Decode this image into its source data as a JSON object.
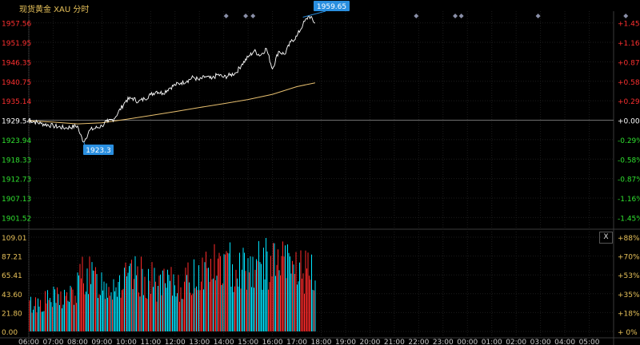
{
  "header": {
    "title": "现货黄金 XAU 分时"
  },
  "controls": {
    "close_label": "X"
  },
  "colors": {
    "background": "#000000",
    "price_line": "#ffffff",
    "avg_line": "#e8c070",
    "up": "#ff2a2a",
    "down": "#00e5ff",
    "axis_up": "#ff3030",
    "axis_down": "#2fe02f",
    "axis_neutral": "#ffffff",
    "volume_label": "#e8c25a",
    "marker": "#8a8fa8",
    "callout_bg": "#2a8fe0"
  },
  "chart_data": [
    {
      "type": "line",
      "title": "",
      "x_ticks": [
        "06:00",
        "07:00",
        "08:00",
        "09:00",
        "10:00",
        "11:00",
        "12:00",
        "13:00",
        "14:00",
        "15:00",
        "16:00",
        "17:00",
        "18:00",
        "19:00",
        "20:00",
        "21:00",
        "22:00",
        "23:00",
        "00:00",
        "01:00",
        "02:00",
        "03:00",
        "04:00",
        "05:00"
      ],
      "y_ticks_price": [
        1957.56,
        1951.95,
        1946.35,
        1940.75,
        1935.14,
        1929.54,
        1923.94,
        1918.33,
        1912.73,
        1907.13,
        1901.52
      ],
      "y_ticks_percent": [
        "+1.45%",
        "+1.16%",
        "+0.87%",
        "+0.58%",
        "+0.29%",
        "+0.00%",
        "-0.29%",
        "-0.58%",
        "-0.87%",
        "-1.16%",
        "-1.45%"
      ],
      "ylim": [
        1900.7,
        1958.4
      ],
      "reference_price": 1929.54,
      "high_label": "1959.65",
      "low_label": "1923.3",
      "session_hours": 24,
      "series": [
        {
          "name": "price",
          "hours": [
            0,
            0.5,
            1,
            1.5,
            2,
            2.1,
            2.25,
            2.5,
            3,
            3.2,
            3.25,
            3.5,
            4,
            4.25,
            4.5,
            4.75,
            5,
            5.25,
            5.5,
            5.75,
            6,
            6.25,
            6.5,
            6.75,
            7,
            7.25,
            7.5,
            7.75,
            8,
            8.25,
            8.5,
            8.75,
            9,
            9.25,
            9.5,
            9.75,
            10,
            10.25,
            10.5,
            10.75,
            11,
            11.25,
            11.5,
            11.75
          ],
          "values": [
            1929.6,
            1928.6,
            1927.9,
            1927.3,
            1927.9,
            1925.6,
            1923.3,
            1926.7,
            1927.9,
            1929.3,
            1929.0,
            1930.0,
            1935.3,
            1935.9,
            1934.9,
            1935.7,
            1936.9,
            1937.9,
            1937.3,
            1938.7,
            1939.7,
            1940.3,
            1940.9,
            1941.9,
            1941.1,
            1942.1,
            1941.4,
            1942.7,
            1941.9,
            1942.5,
            1943.2,
            1945.7,
            1947.7,
            1949.5,
            1948.2,
            1950.2,
            1944.3,
            1949.4,
            1948.5,
            1952.1,
            1953.7,
            1957.1,
            1959.65,
            1957.5
          ]
        },
        {
          "name": "average",
          "hours": [
            0,
            1,
            2,
            3,
            4,
            5,
            6,
            7,
            8,
            9,
            10,
            11,
            11.75
          ],
          "values": [
            1929.4,
            1929.0,
            1928.5,
            1928.8,
            1929.8,
            1930.9,
            1932.0,
            1933.2,
            1934.3,
            1935.5,
            1937.0,
            1939.2,
            1940.3
          ]
        }
      ]
    },
    {
      "type": "bar",
      "title": "",
      "y_ticks": [
        109.01,
        87.21,
        65.41,
        43.6,
        21.8,
        0.0
      ],
      "y_ticks_percent": [
        "+88%",
        "+70%",
        "+53%",
        "+35%",
        "+18%",
        "+ 0%"
      ],
      "ylim": [
        0,
        109.01
      ],
      "x_ticks": [
        "06:00",
        "07:00",
        "08:00",
        "09:00",
        "10:00",
        "11:00",
        "12:00",
        "13:00",
        "14:00",
        "15:00",
        "16:00",
        "17:00",
        "18:00",
        "19:00",
        "20:00",
        "21:00",
        "22:00",
        "23:00",
        "00:00",
        "01:00",
        "02:00",
        "03:00",
        "04:00",
        "05:00"
      ],
      "series": [
        {
          "name": "volume",
          "hour_anchors": [
            0,
            1,
            1.9,
            2.2,
            2.6,
            3.2,
            3.8,
            4.5,
            5.5,
            6.5,
            7.0,
            7.2,
            8.0,
            9.0,
            10.0,
            11.0,
            11.8
          ],
          "value_anchors": [
            40,
            50,
            55,
            92,
            80,
            72,
            75,
            85,
            70,
            75,
            92,
            98,
            100,
            101,
            104,
            100,
            80
          ]
        }
      ]
    }
  ],
  "event_markers": {
    "hours": [
      8.1,
      8.9,
      9.2,
      15.9,
      17.5,
      17.75,
      20.9,
      24.5
    ]
  }
}
